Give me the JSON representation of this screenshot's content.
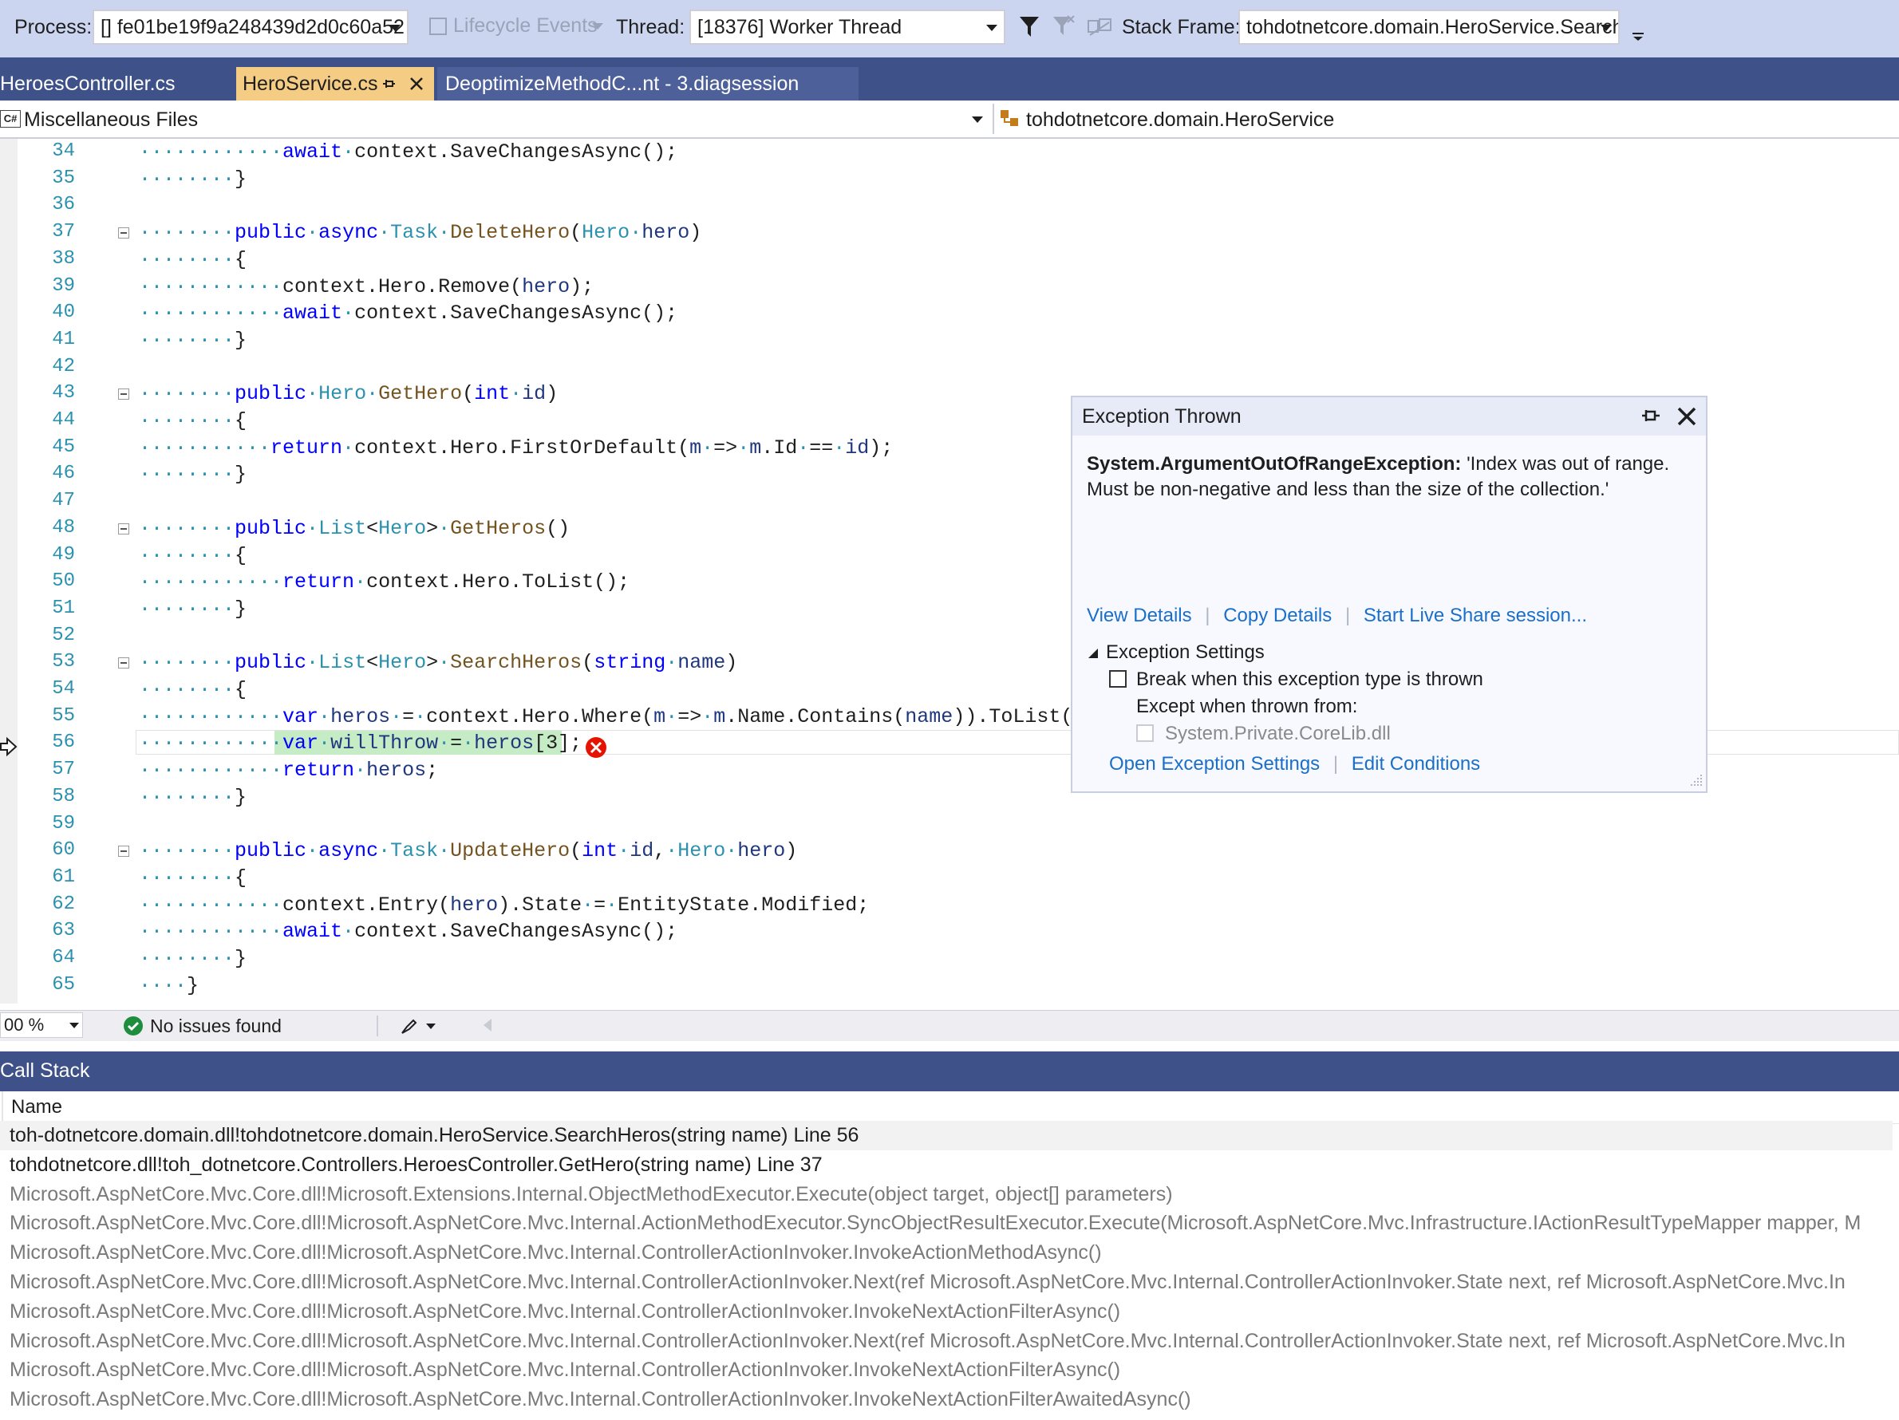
{
  "toolbar": {
    "process_label": "Process:",
    "process_value": "[] fe01be19f9a248439d2d0c60a52",
    "lifecycle_label": "Lifecycle Events",
    "thread_label": "Thread:",
    "thread_value": "[18376] Worker Thread",
    "stack_frame_label": "Stack Frame:",
    "stack_frame_value": "tohdotnetcore.domain.HeroService.SearchH"
  },
  "tabs": [
    {
      "label": "HeroesController.cs",
      "active": false
    },
    {
      "label": "HeroService.cs",
      "active": true
    },
    {
      "label": "DeoptimizeMethodC...nt - 3.diagsession",
      "active": false
    }
  ],
  "navbar": {
    "project": "Miscellaneous Files",
    "class": "tohdotnetcore.domain.HeroService"
  },
  "editor": {
    "current_line": 56,
    "lines": [
      {
        "n": "34",
        "code": "            await context.SaveChangesAsync();"
      },
      {
        "n": "35",
        "code": "        }"
      },
      {
        "n": "36",
        "code": ""
      },
      {
        "n": "37",
        "code": "        public async Task DeleteHero(Hero hero)"
      },
      {
        "n": "38",
        "code": "        {"
      },
      {
        "n": "39",
        "code": "            context.Hero.Remove(hero);"
      },
      {
        "n": "40",
        "code": "            await context.SaveChangesAsync();"
      },
      {
        "n": "41",
        "code": "        }"
      },
      {
        "n": "42",
        "code": ""
      },
      {
        "n": "43",
        "code": "        public Hero GetHero(int id)"
      },
      {
        "n": "44",
        "code": "        {"
      },
      {
        "n": "45",
        "code": "           return context.Hero.FirstOrDefault(m => m.Id == id);"
      },
      {
        "n": "46",
        "code": "        }"
      },
      {
        "n": "47",
        "code": ""
      },
      {
        "n": "48",
        "code": "        public List<Hero> GetHeros()"
      },
      {
        "n": "49",
        "code": "        {"
      },
      {
        "n": "50",
        "code": "            return context.Hero.ToList();"
      },
      {
        "n": "51",
        "code": "        }"
      },
      {
        "n": "52",
        "code": ""
      },
      {
        "n": "53",
        "code": "        public List<Hero> SearchHeros(string name)"
      },
      {
        "n": "54",
        "code": "        {"
      },
      {
        "n": "55",
        "code": "            var heros = context.Hero.Where(m => m.Name.Contains(name)).ToList();"
      },
      {
        "n": "56",
        "code": "            var willThrow = heros[3];"
      },
      {
        "n": "57",
        "code": "            return heros;"
      },
      {
        "n": "58",
        "code": "        }"
      },
      {
        "n": "59",
        "code": ""
      },
      {
        "n": "60",
        "code": "        public async Task UpdateHero(int id, Hero hero)"
      },
      {
        "n": "61",
        "code": "        {"
      },
      {
        "n": "62",
        "code": "            context.Entry(hero).State = EntityState.Modified;"
      },
      {
        "n": "63",
        "code": "            await context.SaveChangesAsync();"
      },
      {
        "n": "64",
        "code": "        }"
      },
      {
        "n": "65",
        "code": "    }"
      }
    ]
  },
  "status": {
    "zoom": "00 %",
    "issues": "No issues found"
  },
  "exception": {
    "title": "Exception Thrown",
    "type": "System.ArgumentOutOfRangeException:",
    "message_line1": "'Index was out of range.",
    "message_line2": "Must be non-negative and less than the size of the collection.'",
    "view_details": "View Details",
    "copy_details": "Copy Details",
    "live_share": "Start Live Share session...",
    "settings_header": "Exception Settings",
    "break_when": "Break when this exception type is thrown",
    "except_when": "Except when thrown from:",
    "corelib": "System.Private.CoreLib.dll",
    "open_settings": "Open Exception Settings",
    "edit_conditions": "Edit Conditions"
  },
  "callstack": {
    "title": "Call Stack",
    "column_name": "Name",
    "rows": [
      {
        "text": "toh-dotnetcore.domain.dll!tohdotnetcore.domain.HeroService.SearchHeros(string name) Line 56",
        "user": true,
        "current": true
      },
      {
        "text": "tohdotnetcore.dll!toh_dotnetcore.Controllers.HeroesController.GetHero(string name) Line 37",
        "user": true,
        "current": false
      },
      {
        "text": "Microsoft.AspNetCore.Mvc.Core.dll!Microsoft.Extensions.Internal.ObjectMethodExecutor.Execute(object target, object[] parameters)",
        "user": false,
        "current": false
      },
      {
        "text": "Microsoft.AspNetCore.Mvc.Core.dll!Microsoft.AspNetCore.Mvc.Internal.ActionMethodExecutor.SyncObjectResultExecutor.Execute(Microsoft.AspNetCore.Mvc.Infrastructure.IActionResultTypeMapper mapper, M",
        "user": false,
        "current": false
      },
      {
        "text": "Microsoft.AspNetCore.Mvc.Core.dll!Microsoft.AspNetCore.Mvc.Internal.ControllerActionInvoker.InvokeActionMethodAsync()",
        "user": false,
        "current": false
      },
      {
        "text": "Microsoft.AspNetCore.Mvc.Core.dll!Microsoft.AspNetCore.Mvc.Internal.ControllerActionInvoker.Next(ref Microsoft.AspNetCore.Mvc.Internal.ControllerActionInvoker.State next, ref Microsoft.AspNetCore.Mvc.In",
        "user": false,
        "current": false
      },
      {
        "text": "Microsoft.AspNetCore.Mvc.Core.dll!Microsoft.AspNetCore.Mvc.Internal.ControllerActionInvoker.InvokeNextActionFilterAsync()",
        "user": false,
        "current": false
      },
      {
        "text": "Microsoft.AspNetCore.Mvc.Core.dll!Microsoft.AspNetCore.Mvc.Internal.ControllerActionInvoker.Next(ref Microsoft.AspNetCore.Mvc.Internal.ControllerActionInvoker.State next, ref Microsoft.AspNetCore.Mvc.In",
        "user": false,
        "current": false
      },
      {
        "text": "Microsoft.AspNetCore.Mvc.Core.dll!Microsoft.AspNetCore.Mvc.Internal.ControllerActionInvoker.InvokeNextActionFilterAsync()",
        "user": false,
        "current": false
      },
      {
        "text": "Microsoft.AspNetCore.Mvc.Core.dll!Microsoft.AspNetCore.Mvc.Internal.ControllerActionInvoker.InvokeNextActionFilterAwaitedAsync()",
        "user": false,
        "current": false
      }
    ]
  },
  "colors": {
    "toolbar_bg": "#ccd5f0",
    "tab_strip_bg": "#3e5188",
    "active_tab_bg": "#f5cc84",
    "keyword": "#0000ff",
    "type": "#2b91af",
    "line_number": "#2b91af",
    "highlight": "#c5ecc5",
    "error": "#e51400",
    "link": "#1a6fc8"
  }
}
